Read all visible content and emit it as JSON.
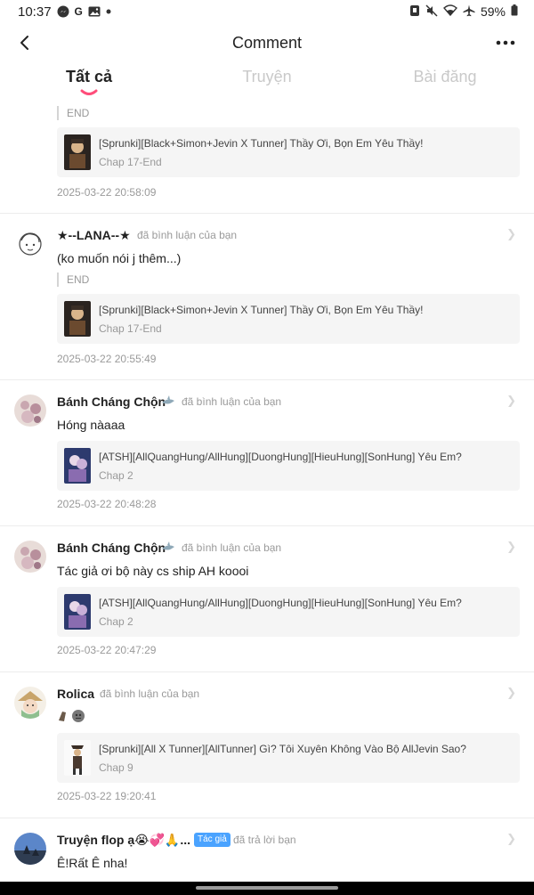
{
  "status_bar": {
    "time": "10:37",
    "left_icons": [
      "messenger-icon",
      "google-icon",
      "photo-icon",
      "dot-icon"
    ],
    "right_icons": [
      "alarm-icon",
      "mute-icon",
      "wifi-icon",
      "airplane-icon"
    ],
    "battery": "59%"
  },
  "header": {
    "title": "Comment",
    "back_icon": "back-arrow-icon",
    "more_icon": "more-icon"
  },
  "tabs": [
    {
      "label": "Tất cả",
      "active": true
    },
    {
      "label": "Truyện",
      "active": false
    },
    {
      "label": "Bài đăng",
      "active": false
    }
  ],
  "accent_color": "#ff4d7a",
  "badge_color": "#4aa3ff",
  "comments": [
    {
      "quote": "END",
      "story_title": "[Sprunki][Black+Simon+Jevin X Tunner] Thầy Ơi, Bọn Em Yêu Thầy!",
      "story_chap": "Chap 17-End",
      "time": "2025-03-22 20:58:09"
    },
    {
      "user": "★--LANA--★",
      "action": "đã bình luận của bạn",
      "text": "(ko muốn nói j thêm...)",
      "quote": "END",
      "story_title": "[Sprunki][Black+Simon+Jevin X Tunner] Thầy Ơi, Bọn Em Yêu Thầy!",
      "story_chap": "Chap 17-End",
      "time": "2025-03-22 20:55:49"
    },
    {
      "user": "Bánh Cháng Chộn",
      "action": "đã bình luận của bạn",
      "text": "Hóng nàaaa",
      "story_title": "[ATSH][AllQuangHung/AllHung][DuongHung][HieuHung][SonHung] Yêu Em?",
      "story_chap": "Chap 2",
      "time": "2025-03-22 20:48:28"
    },
    {
      "user": "Bánh Cháng Chộn",
      "action": "đã bình luận của bạn",
      "text": "Tác giả ơi bộ này cs ship AH koooi",
      "story_title": "[ATSH][AllQuangHung/AllHung][DuongHung][HieuHung][SonHung] Yêu Em?",
      "story_chap": "Chap 2",
      "time": "2025-03-22 20:47:29"
    },
    {
      "user": "Rolica",
      "action": "đã bình luận của bạn",
      "text": "",
      "story_title": "[Sprunki][All X Tunner][AllTunner] Gì? Tôi Xuyên Không Vào Bộ AllJevin Sao?",
      "story_chap": "Chap 9",
      "time": "2025-03-22 19:20:41"
    },
    {
      "user": "Truyện flop ạ😭💞🙏...",
      "badge": "Tác giả",
      "action": "đã trả lời bạn",
      "text": "Ê!Rất Ê nha!"
    }
  ]
}
